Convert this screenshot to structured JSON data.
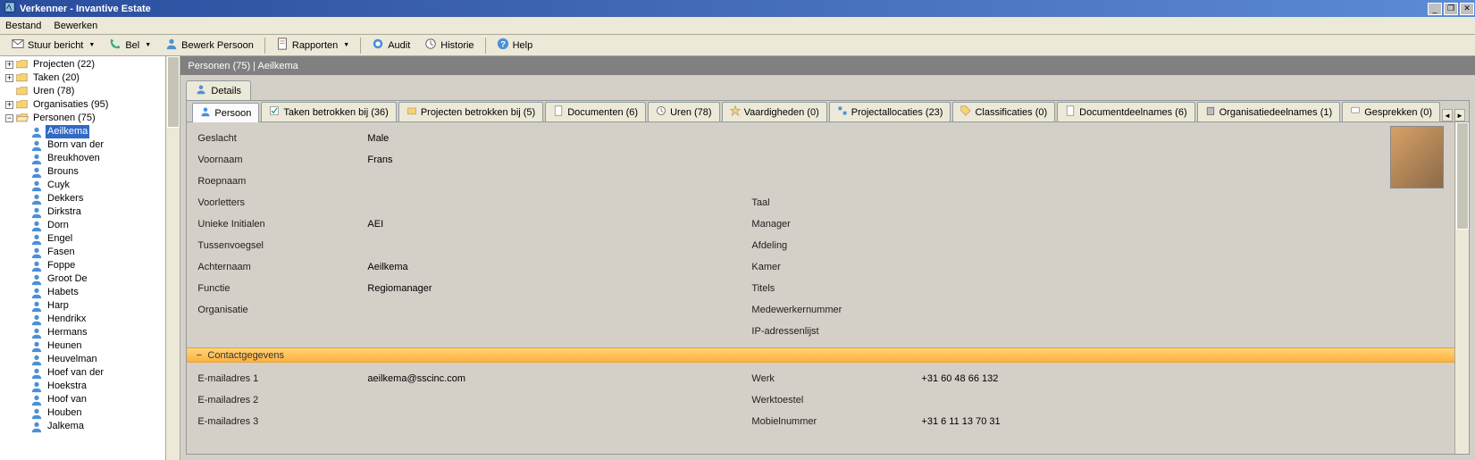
{
  "window": {
    "title": "Verkenner - Invantive Estate"
  },
  "menu": {
    "file": "Bestand",
    "edit": "Bewerken"
  },
  "toolbar": {
    "send": "Stuur bericht",
    "call": "Bel",
    "edit_person": "Bewerk Persoon",
    "reports": "Rapporten",
    "audit": "Audit",
    "history": "Historie",
    "help": "Help"
  },
  "tree": {
    "root0": "Projecten (22)",
    "root1": "Taken (20)",
    "root2": "Uren (78)",
    "root3": "Organisaties (95)",
    "root4": "Personen (75)",
    "people": [
      "Aeilkema",
      "Born van der",
      "Breukhoven",
      "Brouns",
      "Cuyk",
      "Dekkers",
      "Dirkstra",
      "Dorn",
      "Engel",
      "Fasen",
      "Foppe",
      "Groot De",
      "Habets",
      "Harp",
      "Hendrikx",
      "Hermans",
      "Heunen",
      "Heuvelman",
      "Hoef van der",
      "Hoekstra",
      "Hoof van",
      "Houben",
      "Jalkema"
    ]
  },
  "header": {
    "title": "Personen (75) | Aeilkema"
  },
  "tab_details": "Details",
  "subtabs": {
    "t0": "Persoon",
    "t1": "Taken betrokken bij (36)",
    "t2": "Projecten betrokken bij (5)",
    "t3": "Documenten (6)",
    "t4": "Uren (78)",
    "t5": "Vaardigheden (0)",
    "t6": "Projectallocaties (23)",
    "t7": "Classificaties (0)",
    "t8": "Documentdeelnames (6)",
    "t9": "Organisatiedeelnames (1)",
    "t10": "Gesprekken (0)"
  },
  "labels": {
    "geslacht": "Geslacht",
    "voornaam": "Voornaam",
    "roepnaam": "Roepnaam",
    "voorletters": "Voorletters",
    "unieke": "Unieke Initialen",
    "tussen": "Tussenvoegsel",
    "achternaam": "Achternaam",
    "functie": "Functie",
    "organisatie": "Organisatie",
    "taal": "Taal",
    "manager": "Manager",
    "afdeling": "Afdeling",
    "kamer": "Kamer",
    "titels": "Titels",
    "mednr": "Medewerkernummer",
    "iplist": "IP-adressenlijst",
    "email1": "E-mailadres 1",
    "email2": "E-mailadres 2",
    "email3": "E-mailadres 3",
    "werk": "Werk",
    "werktoestel": "Werktoestel",
    "mobiel": "Mobielnummer"
  },
  "values": {
    "geslacht": "Male",
    "voornaam": "Frans",
    "unieke": "AEI",
    "achternaam": "Aeilkema",
    "functie": "Regiomanager",
    "email1": "aeilkema@sscinc.com",
    "werk": "+31 60 48 66 132",
    "mobiel": "+31 6 11 13 70 31"
  },
  "section": {
    "contact": "Contactgegevens"
  }
}
